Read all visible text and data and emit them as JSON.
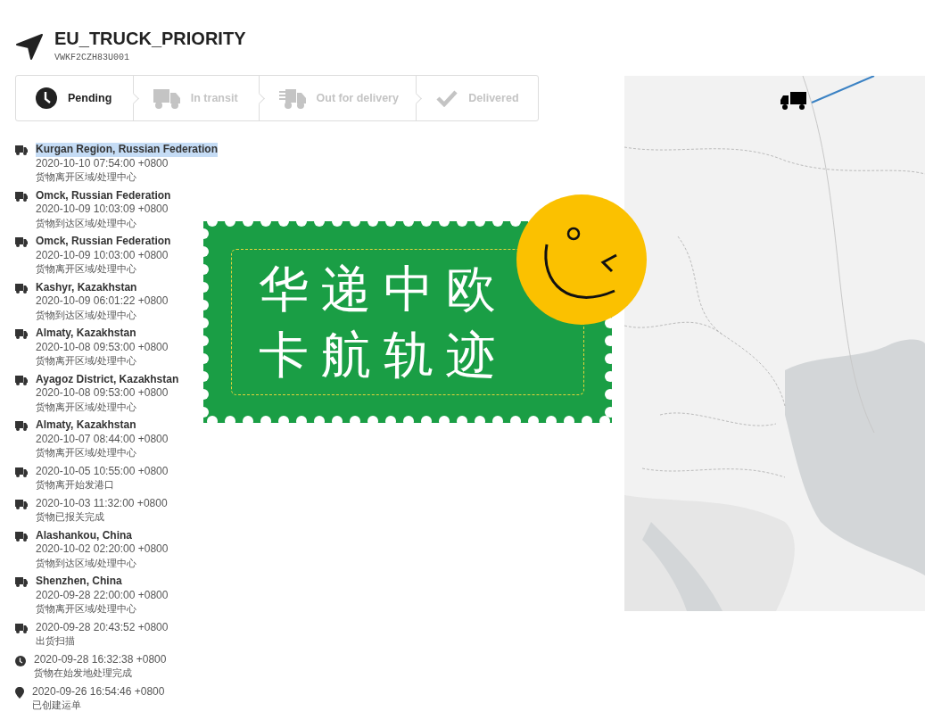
{
  "header": {
    "title": "EU_TRUCK_PRIORITY",
    "tracking_number": "VWKF2CZH83U001"
  },
  "steps": [
    {
      "label": "Pending",
      "kind": "clock",
      "selected": true
    },
    {
      "label": "In transit",
      "kind": "truck",
      "selected": false
    },
    {
      "label": "Out for delivery",
      "kind": "fast-truck",
      "selected": false
    },
    {
      "label": "Delivered",
      "kind": "check",
      "selected": false
    }
  ],
  "events": [
    {
      "kind": "truck",
      "location": "Kurgan Region, Russian Federation",
      "time": "2020-10-10 07:54:00 +0800",
      "status": "货物离开区域/处理中心",
      "selected": true
    },
    {
      "kind": "truck",
      "location": "Omck, Russian Federation",
      "time": "2020-10-09 10:03:09 +0800",
      "status": "货物到达区域/处理中心",
      "selected": false
    },
    {
      "kind": "truck",
      "location": "Omck, Russian Federation",
      "time": "2020-10-09 10:03:00 +0800",
      "status": "货物离开区域/处理中心",
      "selected": false
    },
    {
      "kind": "truck",
      "location": "Kashyr, Kazakhstan",
      "time": "2020-10-09 06:01:22 +0800",
      "status": "货物到达区域/处理中心",
      "selected": false
    },
    {
      "kind": "truck",
      "location": "Almaty, Kazakhstan",
      "time": "2020-10-08 09:53:00 +0800",
      "status": "货物离开区域/处理中心",
      "selected": false
    },
    {
      "kind": "truck",
      "location": "Ayagoz District, Kazakhstan",
      "time": "2020-10-08 09:53:00 +0800",
      "status": "货物离开区域/处理中心",
      "selected": false
    },
    {
      "kind": "truck",
      "location": "Almaty, Kazakhstan",
      "time": "2020-10-07 08:44:00 +0800",
      "status": "货物离开区域/处理中心",
      "selected": false
    },
    {
      "kind": "truck",
      "time": "2020-10-05 10:55:00 +0800",
      "status": "货物离开始发港口",
      "selected": false
    },
    {
      "kind": "truck",
      "time": "2020-10-03 11:32:00 +0800",
      "status": "货物已报关完成",
      "selected": false
    },
    {
      "kind": "truck",
      "location": "Alashankou, China",
      "time": "2020-10-02 02:20:00 +0800",
      "status": "货物到达区域/处理中心",
      "selected": false
    },
    {
      "kind": "truck",
      "location": "Shenzhen, China",
      "time": "2020-09-28 22:00:00 +0800",
      "status": "货物离开区域/处理中心",
      "selected": false
    },
    {
      "kind": "truck",
      "time": "2020-09-28 20:43:52 +0800",
      "status": "出货扫描",
      "selected": false
    },
    {
      "kind": "clock",
      "time": "2020-09-28 16:32:38 +0800",
      "status": "货物在始发地处理完成",
      "selected": false
    },
    {
      "kind": "pin",
      "time": "2020-09-26 16:54:46 +0800",
      "status": "已创建运单",
      "selected": false
    }
  ],
  "banner": {
    "lines": [
      "华递中欧",
      "卡航轨迹"
    ]
  }
}
